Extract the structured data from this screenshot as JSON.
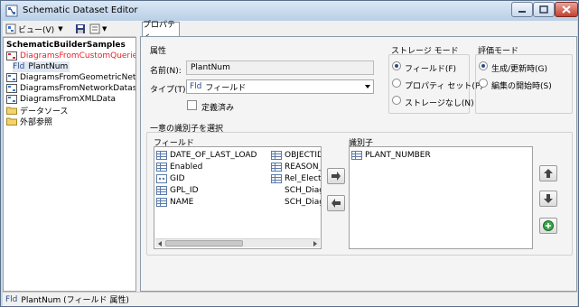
{
  "window": {
    "title": "Schematic Dataset Editor"
  },
  "colors": {
    "accent": "#2a4d88",
    "titlebar": "#c6d8ea",
    "red_item": "#e8202a",
    "close": "#c7402f"
  },
  "toolbar": {
    "view_label": "ビュー(V)"
  },
  "tree": {
    "root": "SchematicBuilderSamples",
    "items": [
      {
        "label": "DiagramsFromCustomQueries",
        "icon": "diagram-red-icon"
      },
      {
        "label": "PlantNum",
        "icon": "field-icon",
        "prefix": "Fld"
      },
      {
        "label": "DiagramsFromGeometricNetwo",
        "icon": "diagram-icon"
      },
      {
        "label": "DiagramsFromNetworkDataset",
        "icon": "diagram-icon"
      },
      {
        "label": "DiagramsFromXMLData",
        "icon": "diagram-icon"
      },
      {
        "label": "データソース",
        "icon": "folder-icon"
      },
      {
        "label": "外部参照",
        "icon": "folder-icon"
      }
    ]
  },
  "tabs": [
    {
      "label": "プロパティ"
    }
  ],
  "properties": {
    "section_label": "属性",
    "name_label": "名前(N):",
    "name_value": "PlantNum",
    "type_label": "タイプ(T):",
    "type_prefix": "Fld",
    "type_value": "フィールド",
    "defined_label": "定義済み",
    "storage_title": "ストレージ モード",
    "storage_options": [
      "フィールド(F)",
      "プロパティ セット(P)",
      "ストレージなし(N)"
    ],
    "eval_title": "評価モード",
    "eval_options": [
      "生成/更新時(G)",
      "編集の開始時(S)"
    ]
  },
  "identifier": {
    "title": "一意の識別子を選択",
    "fields_label": "フィールド",
    "identifier_label": "識別子",
    "fields_col1": [
      "DATE_OF_LAST_LOAD",
      "Enabled",
      "GID",
      "GPL_ID",
      "NAME"
    ],
    "fields_col2": [
      "OBJECTID",
      "REASON_",
      "Rel_Electr",
      "SCH_Diag",
      "SCH_Diag"
    ],
    "selected": [
      "PLANT_NUMBER"
    ]
  },
  "status": {
    "prefix": "Fld",
    "text": "PlantNum (フィールド 属性)"
  }
}
